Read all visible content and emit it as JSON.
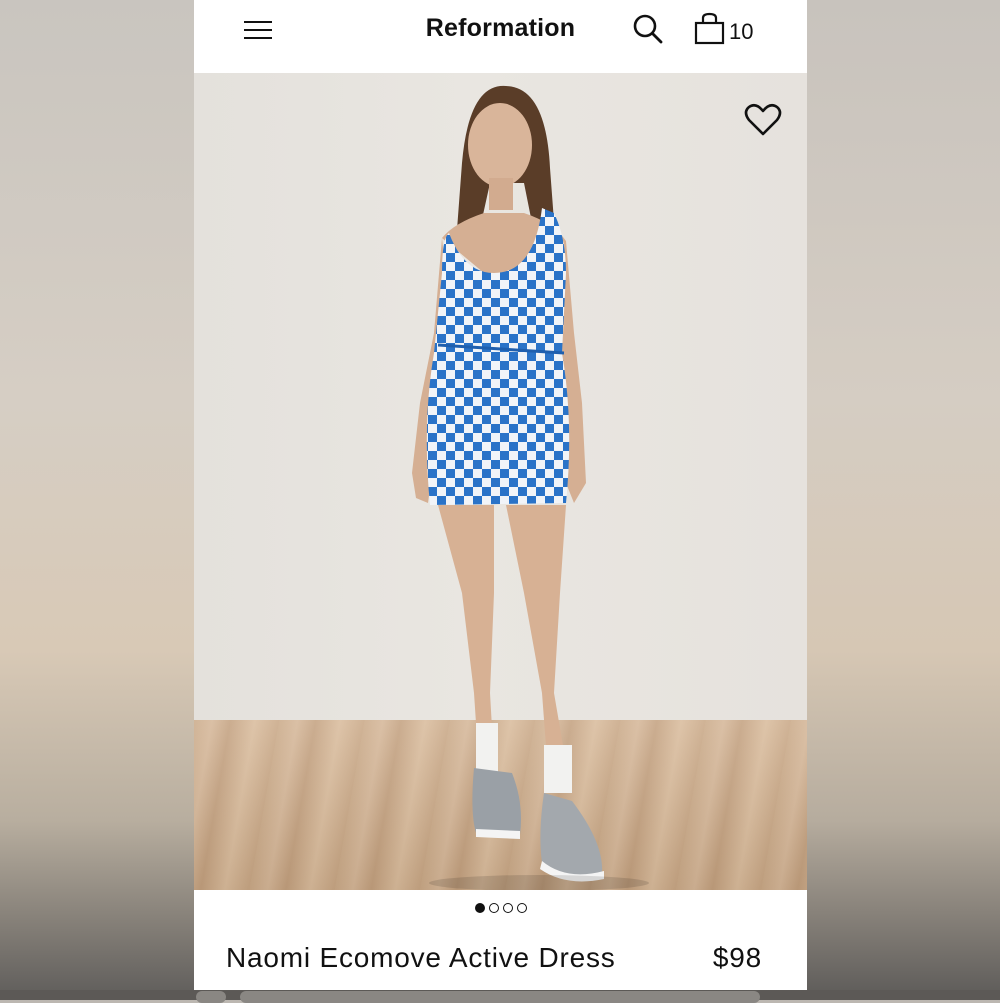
{
  "header": {
    "brand": "Reformation",
    "cart_count": "10"
  },
  "hero": {
    "image_description": "",
    "favorite_icon": "heart-icon"
  },
  "pager": {
    "total": 4,
    "active_index": 0
  },
  "product": {
    "name": "Naomi Ecomove Active Dress",
    "price": "$98"
  },
  "colors": {
    "dress_blue": "#2a73c8",
    "text": "#111111"
  }
}
